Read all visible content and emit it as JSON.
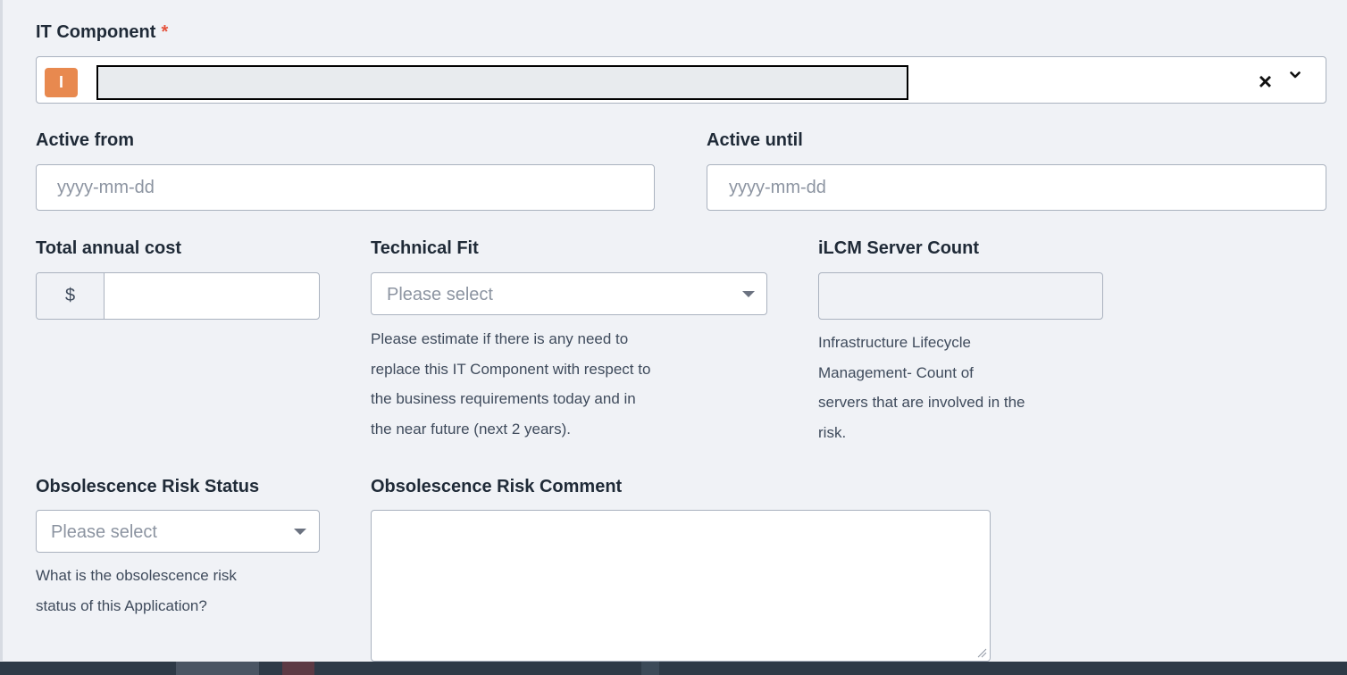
{
  "it_component": {
    "label": "IT Component",
    "required_mark": "*",
    "type_badge": "I",
    "clear_icon": "close-icon",
    "dropdown_icon": "chevron-down-icon"
  },
  "active_from": {
    "label": "Active from",
    "placeholder": "yyyy-mm-dd"
  },
  "active_until": {
    "label": "Active until",
    "placeholder": "yyyy-mm-dd"
  },
  "total_annual_cost": {
    "label": "Total annual cost",
    "currency_symbol": "$",
    "value": ""
  },
  "technical_fit": {
    "label": "Technical Fit",
    "placeholder": "Please select",
    "help_lines": [
      "Please estimate if there is any need to",
      "replace this IT Component with respect to",
      "the business requirements today and in",
      "the near future (next 2 years)."
    ]
  },
  "ilcm_server_count": {
    "label": "iLCM Server Count",
    "value": "",
    "help_lines": [
      "Infrastructure Lifecycle",
      "Management- Count of",
      "servers that are involved in the",
      "risk."
    ]
  },
  "obsolescence_risk_status": {
    "label": "Obsolescence Risk Status",
    "placeholder": "Please select",
    "help_lines": [
      "What is the obsolescence risk",
      "status of this Application?"
    ]
  },
  "obsolescence_risk_comment": {
    "label": "Obsolescence Risk Comment",
    "value": ""
  },
  "colors": {
    "badge": "#e8894f",
    "required": "#e5533d",
    "taskbar": "#2e3a47"
  }
}
